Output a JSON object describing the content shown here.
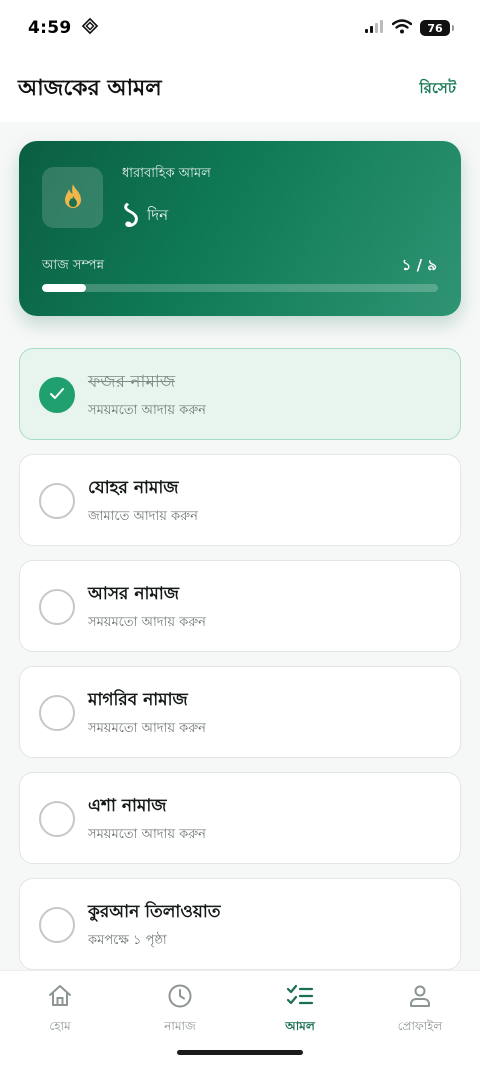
{
  "status_bar": {
    "time": "4:59",
    "battery": "76"
  },
  "header": {
    "title": "আজকের আমল",
    "reset_label": "রিসেট"
  },
  "streak": {
    "label": "ধারাবাহিক আমল",
    "count": "১",
    "unit": "দিন",
    "today_label": "আজ সম্পন্ন",
    "today_progress": "১ / ৯",
    "progress_fraction": 0.11,
    "icon": "flame-icon"
  },
  "amal_items": [
    {
      "title": "ফজর নামাজ",
      "subtitle": "সময়মতো আদায় করুন",
      "done": true
    },
    {
      "title": "যোহর নামাজ",
      "subtitle": "জামাতে আদায় করুন",
      "done": false
    },
    {
      "title": "আসর নামাজ",
      "subtitle": "সময়মতো আদায় করুন",
      "done": false
    },
    {
      "title": "মাগরিব নামাজ",
      "subtitle": "সময়মতো আদায় করুন",
      "done": false
    },
    {
      "title": "এশা নামাজ",
      "subtitle": "সময়মতো আদায় করুন",
      "done": false
    },
    {
      "title": "কুরআন তিলাওয়াত",
      "subtitle": "কমপক্ষে ১ পৃষ্ঠা",
      "done": false
    }
  ],
  "nav": {
    "items": [
      {
        "label": "হোম",
        "icon": "home-icon",
        "active": false
      },
      {
        "label": "নামাজ",
        "icon": "clock-icon",
        "active": false
      },
      {
        "label": "আমল",
        "icon": "checklist-icon",
        "active": true
      },
      {
        "label": "প্রোফাইল",
        "icon": "user-icon",
        "active": false
      }
    ]
  },
  "colors": {
    "primary": "#1a7a55",
    "card_dark": "#0b5e42",
    "done_bg": "#e8f5ef",
    "check_green": "#20a06f"
  }
}
